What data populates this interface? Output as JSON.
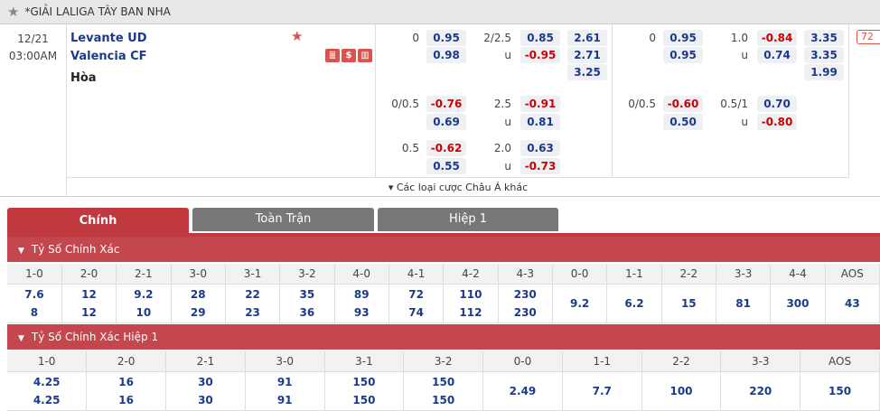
{
  "league": {
    "title": "*GIẢI LALIGA TÂY BAN NHA"
  },
  "match": {
    "date": "12/21",
    "time": "03:00AM",
    "home": "Levante UD",
    "away": "Valencia CF",
    "draw": "Hòa",
    "badge": "72",
    "icon_labels": [
      "≣",
      "$",
      "▥"
    ],
    "more_label": "▾ Các loại cược Châu Á khác"
  },
  "market1": {
    "rows": [
      {
        "hcp": "0",
        "h_odd": "0.95",
        "h_sign": "pos",
        "ou": "2/2.5",
        "o_odd": "0.85",
        "o_sign": "pos",
        "x12": "2.61"
      },
      {
        "hcp": "",
        "h_odd": "0.98",
        "h_sign": "pos",
        "ou": "u",
        "o_odd": "-0.95",
        "o_sign": "neg",
        "x12": "2.71"
      },
      {
        "hcp": "",
        "h_odd": "",
        "h_sign": "pos",
        "ou": "",
        "o_odd": "",
        "o_sign": "pos",
        "x12": "3.25"
      },
      {
        "hcp": "0/0.5",
        "h_odd": "-0.76",
        "h_sign": "neg",
        "ou": "2.5",
        "o_odd": "-0.91",
        "o_sign": "neg",
        "x12": ""
      },
      {
        "hcp": "",
        "h_odd": "0.69",
        "h_sign": "pos",
        "ou": "u",
        "o_odd": "0.81",
        "o_sign": "pos",
        "x12": ""
      },
      {
        "hcp": "0.5",
        "h_odd": "-0.62",
        "h_sign": "neg",
        "ou": "2.0",
        "o_odd": "0.63",
        "o_sign": "pos",
        "x12": ""
      },
      {
        "hcp": "",
        "h_odd": "0.55",
        "h_sign": "pos",
        "ou": "u",
        "o_odd": "-0.73",
        "o_sign": "neg",
        "x12": ""
      }
    ]
  },
  "market2": {
    "rows": [
      {
        "hcp": "0",
        "h_odd": "0.95",
        "h_sign": "pos",
        "ou": "1.0",
        "o_odd": "-0.84",
        "o_sign": "neg",
        "x12": "3.35"
      },
      {
        "hcp": "",
        "h_odd": "0.95",
        "h_sign": "pos",
        "ou": "u",
        "o_odd": "0.74",
        "o_sign": "pos",
        "x12": "3.35"
      },
      {
        "hcp": "",
        "h_odd": "",
        "h_sign": "pos",
        "ou": "",
        "o_odd": "",
        "o_sign": "pos",
        "x12": "1.99"
      },
      {
        "hcp": "0/0.5",
        "h_odd": "-0.60",
        "h_sign": "neg",
        "ou": "0.5/1",
        "o_odd": "0.70",
        "o_sign": "pos",
        "x12": ""
      },
      {
        "hcp": "",
        "h_odd": "0.50",
        "h_sign": "pos",
        "ou": "u",
        "o_odd": "-0.80",
        "o_sign": "neg",
        "x12": ""
      }
    ]
  },
  "tabs": {
    "main": "Chính",
    "full": "Toàn Trận",
    "half": "Hiệp 1"
  },
  "section1": {
    "title": "Tỷ Số Chính Xác",
    "headers": [
      "1-0",
      "2-0",
      "2-1",
      "3-0",
      "3-1",
      "3-2",
      "4-0",
      "4-1",
      "4-2",
      "4-3",
      "0-0",
      "1-1",
      "2-2",
      "3-3",
      "4-4",
      "AOS"
    ],
    "row_home": [
      "7.6",
      "12",
      "9.2",
      "28",
      "22",
      "35",
      "89",
      "72",
      "110",
      "230"
    ],
    "row_away": [
      "8",
      "12",
      "10",
      "29",
      "23",
      "36",
      "93",
      "74",
      "112",
      "230"
    ],
    "single": [
      "9.2",
      "6.2",
      "15",
      "81",
      "300",
      "43"
    ]
  },
  "section2": {
    "title": "Tỷ Số Chính Xác Hiệp 1",
    "headers": [
      "1-0",
      "2-0",
      "2-1",
      "3-0",
      "3-1",
      "3-2",
      "0-0",
      "1-1",
      "2-2",
      "3-3",
      "AOS"
    ],
    "row_home": [
      "4.25",
      "16",
      "30",
      "91",
      "150",
      "150"
    ],
    "row_away": [
      "4.25",
      "16",
      "30",
      "91",
      "150",
      "150"
    ],
    "single": [
      "2.49",
      "7.7",
      "100",
      "220",
      "150"
    ]
  }
}
